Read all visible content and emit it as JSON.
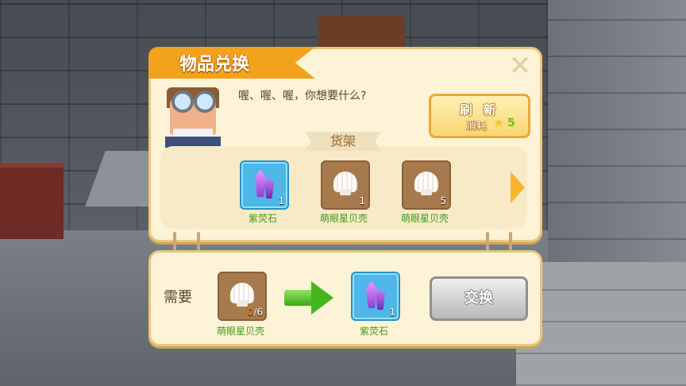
{
  "dialog": {
    "title": "物品兑换",
    "close_icon": "close-x-icon",
    "greeting": "喔、喔、喔，你想要什么?"
  },
  "refresh": {
    "label": "刷 新",
    "cost_label": "消耗",
    "cost_icon": "star-icon",
    "cost_value": "5"
  },
  "shelf": {
    "label": "货架",
    "items": [
      {
        "name": "紫荧石",
        "count": "1",
        "icon": "purple-crystal-icon",
        "selected": true
      },
      {
        "name": "萌眼星贝壳",
        "count": "1",
        "icon": "seashell-icon",
        "selected": false
      },
      {
        "name": "萌眼星贝壳",
        "count": "5",
        "icon": "seashell-icon",
        "selected": false
      }
    ]
  },
  "exchange": {
    "need_label": "需要",
    "required": {
      "name": "萌眼星贝壳",
      "have": "0",
      "total": "/6",
      "icon": "seashell-icon"
    },
    "reward": {
      "name": "紫荧石",
      "count": "1",
      "icon": "purple-crystal-icon"
    },
    "button_label": "交换"
  },
  "colors": {
    "title_ribbon": "#f3a21d",
    "panel_bg": "#fdf3d6",
    "item_name": "#3d9a1a",
    "selected_slot": "#4fb7e8"
  }
}
